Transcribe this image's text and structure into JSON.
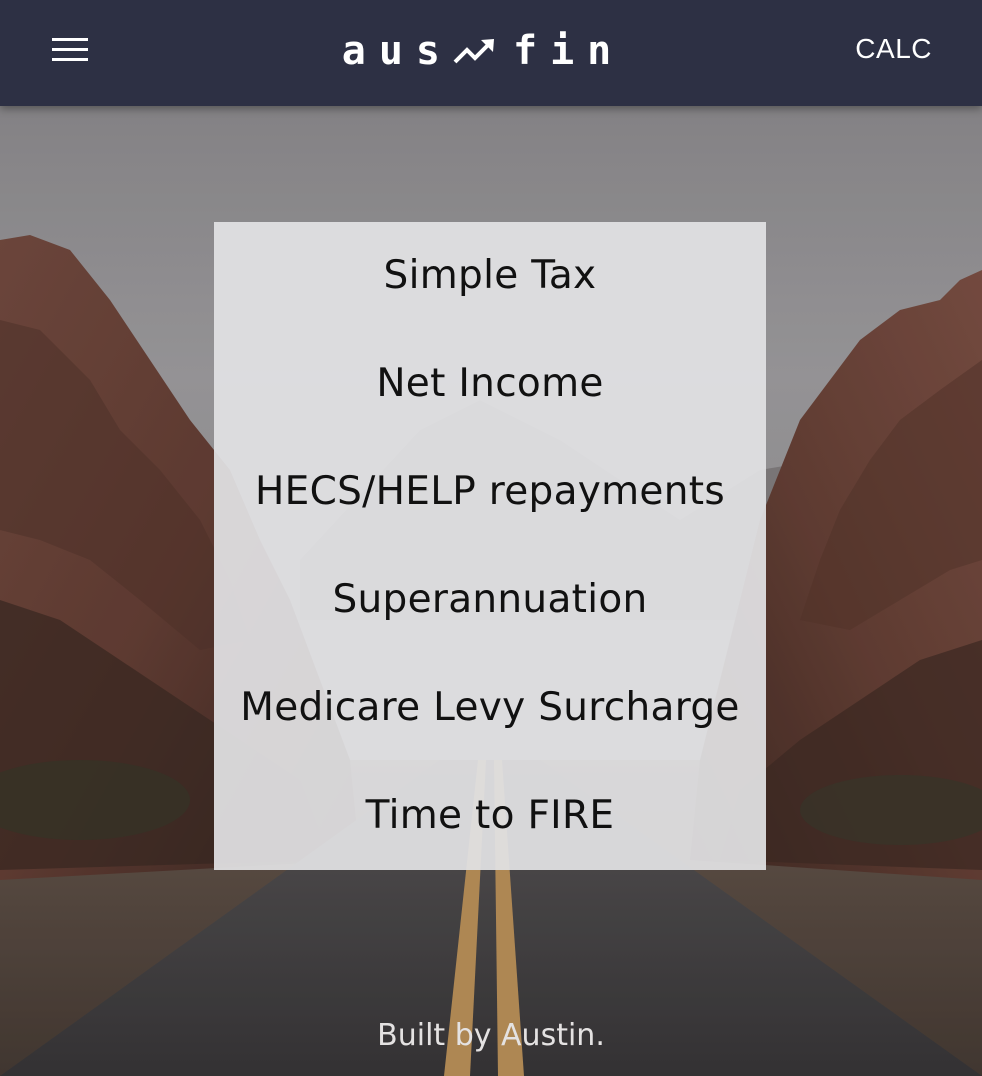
{
  "header": {
    "menu_icon": "hamburger-menu-icon",
    "brand_left": "aus",
    "brand_icon": "trending-up-icon",
    "brand_right": "fin",
    "nav_link": "CALC"
  },
  "menu": {
    "items": [
      {
        "label": "Simple Tax"
      },
      {
        "label": "Net Income"
      },
      {
        "label": "HECS/HELP repayments"
      },
      {
        "label": "Superannuation"
      },
      {
        "label": "Medicare Levy Surcharge"
      },
      {
        "label": "Time to FIRE"
      }
    ]
  },
  "footer": {
    "text": "Built by Austin."
  },
  "colors": {
    "header_bg": "#2d3044",
    "header_text": "#ffffff",
    "card_bg": "#e2e2e4",
    "card_text": "#111111",
    "footer_text": "#e4e2e2"
  }
}
